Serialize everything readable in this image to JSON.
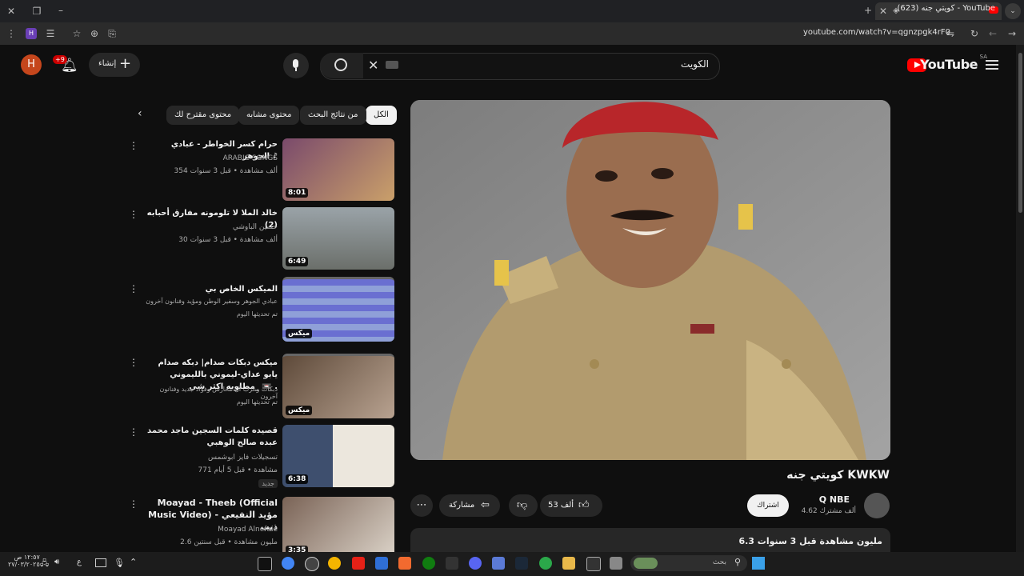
{
  "browser": {
    "tab_title": "(623) كويتي جنه - YouTube",
    "url": "youtube.com/watch?v=qgnzpgk4rF0"
  },
  "header": {
    "logo_text": "YouTube",
    "region": "SA",
    "search_value": "الكويت",
    "create_label": "إنشاء",
    "notifications_badge": "+9",
    "avatar_letter": "H"
  },
  "chips": [
    "الكل",
    "من نتائج البحث",
    "محتوى مشابه",
    "محتوى مقترح لك"
  ],
  "video": {
    "title": "كويتي جنه KWKW",
    "channel": "Q NBE",
    "subscribers": "4.62 ألف مشترك",
    "subscribe_label": "اشتراك",
    "likes": "53 ألف",
    "share_label": "مشاركة",
    "views": "6.3 مليون مشاهدة  قبل 3 سنوات"
  },
  "related": [
    {
      "title": "حرام كسر الخواطر - عبادي الجوهر ♪",
      "channel": "ARABIC SONGS",
      "meta": "354 ألف مشاهدة • قبل 3 سنوات",
      "duration": "8:01"
    },
    {
      "title": "خالد الملا لا تلومونه مفارق أحبابه (2)",
      "channel": "حسين الباوشي",
      "meta": "30 ألف مشاهدة • قبل 3 سنوات",
      "duration": "6:49"
    },
    {
      "title": "الميكس الخاص بي",
      "channel": "عبادي الجوهر وسفير الوطن ومؤيد وفنانون آخرون",
      "meta": "تم تحديثها اليوم",
      "duration": "ميكس"
    },
    {
      "title": "ميكس دبكات صدام| دبكه صدام يابو عداي-ليموني بالليموني _مطلوبه اكثر شي 📼 .",
      "channel": "دبكات وعرب آل محارس وفؤاد جديد وفنانون آخرون",
      "meta": "تم تحديثها اليوم",
      "duration": "ميكس"
    },
    {
      "title": "قصيده كلمات السجين ماجد محمد عبده صالح الوهبي",
      "channel": "تسجيلات فايز ابوشمس",
      "meta": "771 مشاهدة • قبل 5 أيام",
      "badge": "جديد",
      "duration": "6:38"
    },
    {
      "title": "Moayad - Theeb (Official Music Video) مؤيد النفيعي - ذيب",
      "channel": "Moayad Alnefaie",
      "meta": "2.6 مليون مشاهدة • قبل سنتين",
      "duration": "3:35"
    }
  ],
  "taskbar": {
    "search_placeholder": "بحث",
    "time": "١٢:٥٧ ص",
    "date": "٢٧/٠٣/٢٠٢٥",
    "lang": "ع"
  }
}
